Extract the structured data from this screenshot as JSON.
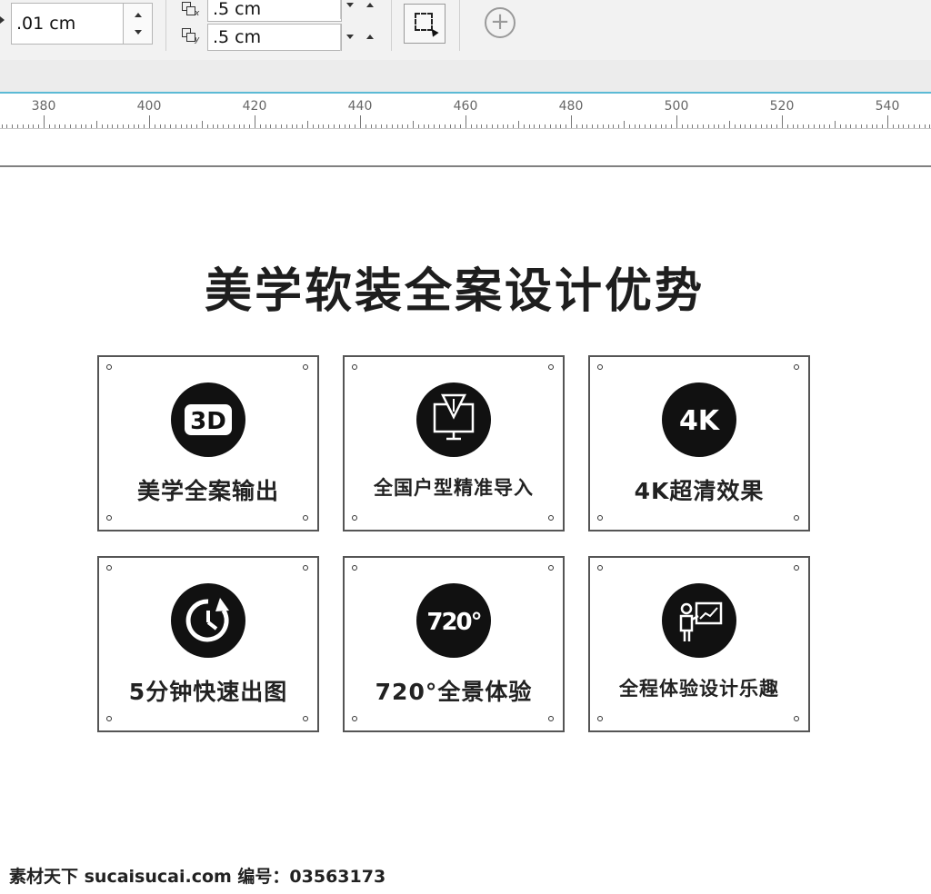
{
  "toolbar": {
    "outline_width": ".01 cm",
    "offset_x": ".5 cm",
    "offset_y": ".5 cm",
    "offset_x_axis": "x",
    "offset_y_axis": "y"
  },
  "ruler": {
    "labels": [
      "380",
      "400",
      "420",
      "440",
      "460",
      "480",
      "500",
      "520",
      "540"
    ]
  },
  "artwork": {
    "headline": "美学软装全案设计优势",
    "cards": [
      {
        "label": "美学全案输出",
        "icon": "3d-icon",
        "icon_text": "3D"
      },
      {
        "label": "全国户型精准导入",
        "icon": "monitor-import-icon"
      },
      {
        "label": "4K超清效果",
        "icon": "4k-icon",
        "icon_text": "4K"
      },
      {
        "label": "5分钟快速出图",
        "icon": "clock-refresh-icon"
      },
      {
        "label": "720°全景体验",
        "icon": "720-icon",
        "icon_text": "720°"
      },
      {
        "label": "全程体验设计乐趣",
        "icon": "presenter-icon"
      }
    ]
  },
  "watermark": "素材天下 sucaisucai.com  编号：03563173"
}
